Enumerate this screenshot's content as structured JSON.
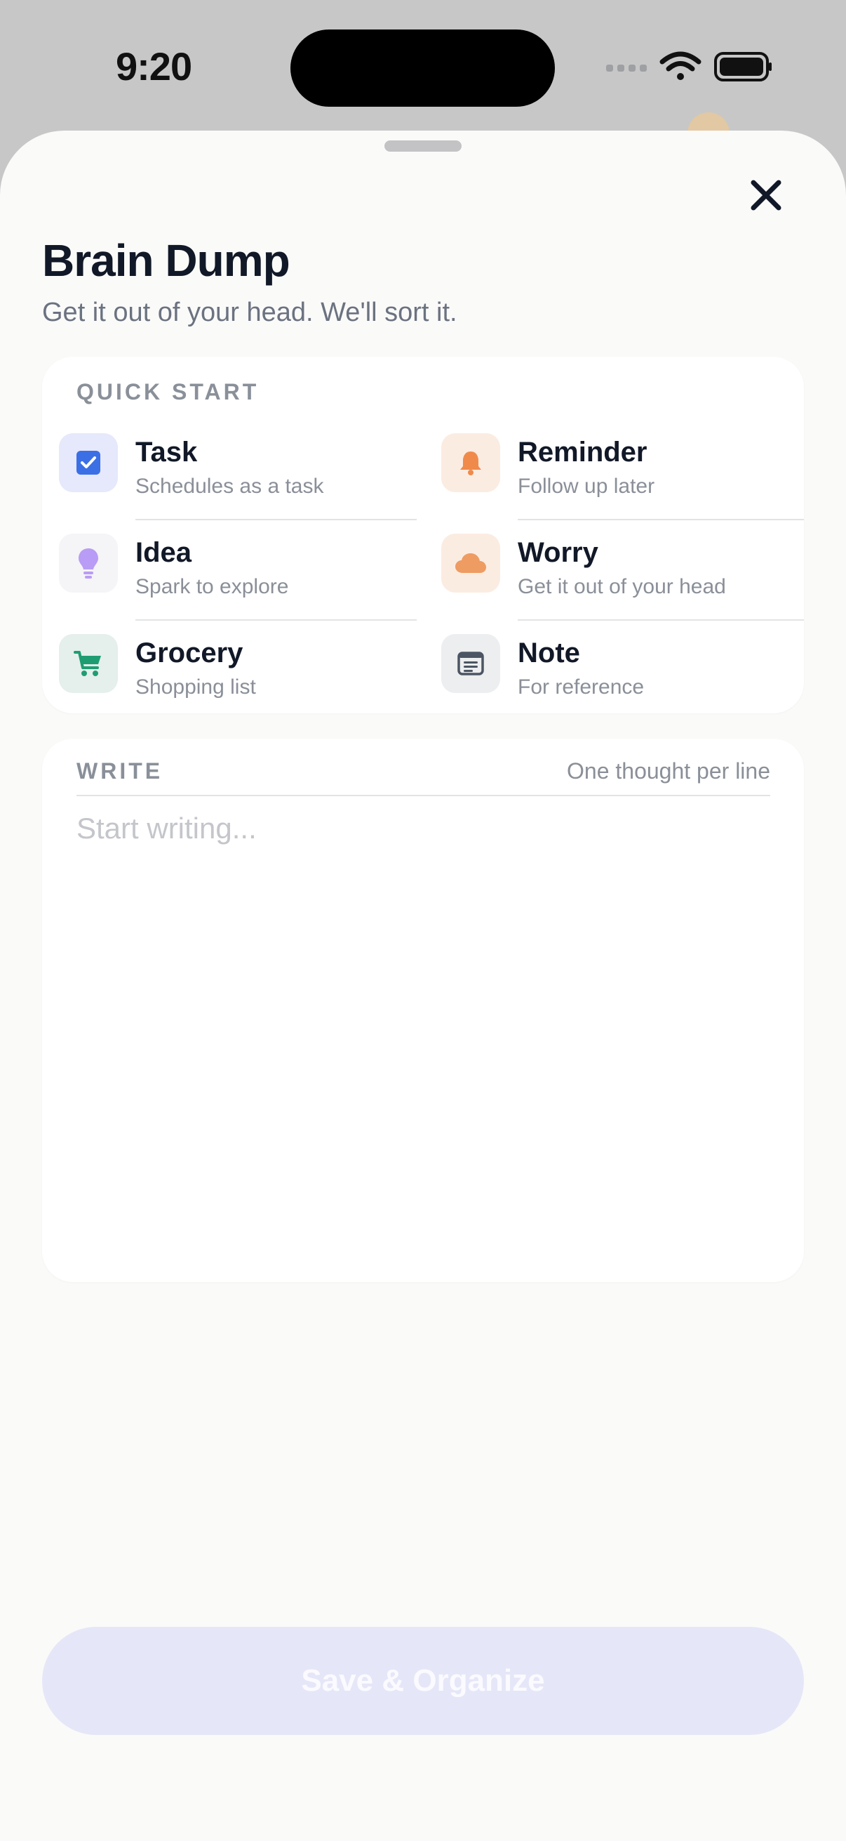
{
  "status_bar": {
    "time": "9:20"
  },
  "sheet": {
    "title": "Brain Dump",
    "subtitle": "Get it out of your head. We'll sort it."
  },
  "quick_start": {
    "label": "QUICK START",
    "items": [
      {
        "title": "Task",
        "subtitle": "Schedules as a task",
        "icon": "checkbox-icon",
        "color": "#3b6fe6",
        "bg": "#e6e8fb"
      },
      {
        "title": "Reminder",
        "subtitle": "Follow up later",
        "icon": "bell-icon",
        "color": "#f08a4b",
        "bg": "#fbece2"
      },
      {
        "title": "Idea",
        "subtitle": "Spark to explore",
        "icon": "lightbulb-icon",
        "color": "#b99cf5",
        "bg": "#f5f4f6"
      },
      {
        "title": "Worry",
        "subtitle": "Get it out of your head",
        "icon": "cloud-icon",
        "color": "#ee9c62",
        "bg": "#fbece2"
      },
      {
        "title": "Grocery",
        "subtitle": "Shopping list",
        "icon": "cart-icon",
        "color": "#1f9d72",
        "bg": "#e5efec"
      },
      {
        "title": "Note",
        "subtitle": "For reference",
        "icon": "note-icon",
        "color": "#4b5563",
        "bg": "#eceeef"
      }
    ]
  },
  "write": {
    "label": "WRITE",
    "hint": "One thought per line",
    "placeholder": "Start writing...",
    "value": ""
  },
  "actions": {
    "save_label": "Save & Organize"
  },
  "colors": {
    "accent": "#5b63e8",
    "title": "#111827",
    "muted": "#8a8f98"
  }
}
